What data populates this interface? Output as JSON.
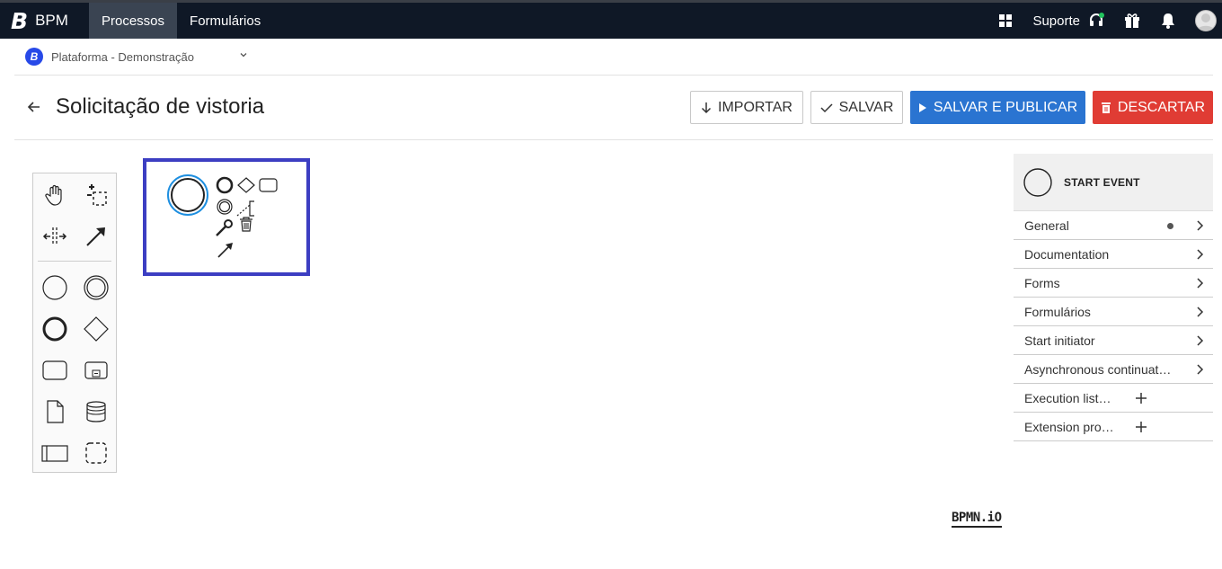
{
  "topbar": {
    "brand_letter": "B",
    "brand_text": "BPM",
    "nav": [
      {
        "label": "Processos",
        "active": true
      },
      {
        "label": "Formulários",
        "active": false
      }
    ],
    "support_label": "Suporte",
    "icons": [
      "grid-icon",
      "headset-icon",
      "gift-icon",
      "bell-icon",
      "avatar"
    ]
  },
  "platform": {
    "logo_letter": "B",
    "name": "Plataforma - Demonstração"
  },
  "header": {
    "title": "Solicitação de vistoria",
    "buttons": {
      "import": "IMPORTAR",
      "save": "SALVAR",
      "save_publish": "SALVAR E PUBLICAR",
      "discard": "DESCARTAR"
    }
  },
  "palette": {
    "tools": [
      "hand-tool",
      "lasso-tool",
      "space-tool",
      "global-connect-tool"
    ],
    "shapes": [
      "start-event",
      "intermediate-event",
      "end-event",
      "gateway",
      "task",
      "subprocess",
      "data-object",
      "data-store",
      "pool",
      "group"
    ]
  },
  "properties": {
    "element_type": "START EVENT",
    "groups": [
      {
        "label": "General",
        "control": "chevron",
        "dot": true
      },
      {
        "label": "Documentation",
        "control": "chevron",
        "dot": false
      },
      {
        "label": "Forms",
        "control": "chevron",
        "dot": false
      },
      {
        "label": "Formulários",
        "control": "chevron",
        "dot": false
      },
      {
        "label": "Start initiator",
        "control": "chevron",
        "dot": false
      },
      {
        "label": "Asynchronous continuat…",
        "control": "chevron",
        "dot": false
      },
      {
        "label": "Execution list…",
        "control": "plus",
        "dot": false
      },
      {
        "label": "Extension pro…",
        "control": "plus",
        "dot": false
      }
    ]
  },
  "watermark": "BPMN.iO",
  "colors": {
    "topbar_bg": "#0f1826",
    "nav_active": "#3a4452",
    "primary": "#2a74d1",
    "danger": "#e03c34",
    "selection": "#3c3ec2",
    "event_highlight": "#1e8fe0"
  }
}
